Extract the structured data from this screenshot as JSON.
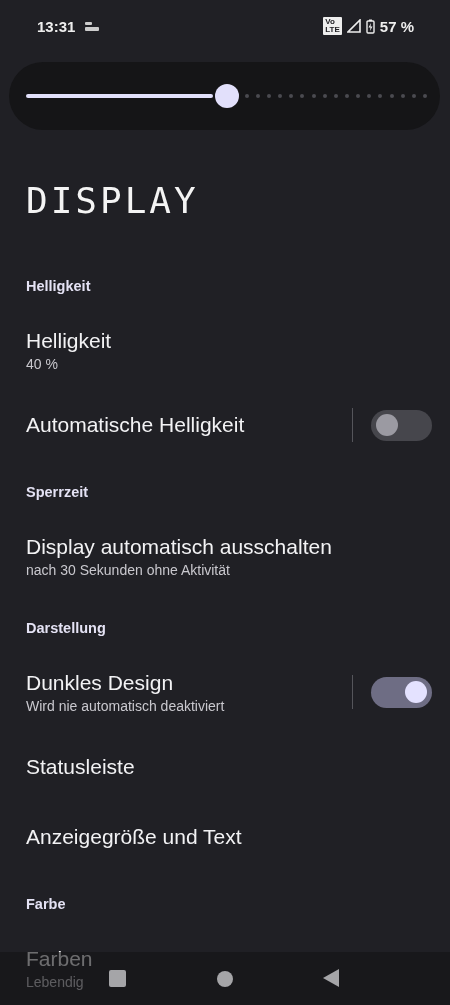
{
  "status_bar": {
    "time": "13:31",
    "network_badge": [
      "Vo",
      "LTE"
    ],
    "battery": "57 %"
  },
  "brightness_slider": {
    "level": 0.5
  },
  "title": "DISPLAY",
  "settings": [
    {
      "kind": "header",
      "title": "Helligkeit"
    },
    {
      "kind": "item",
      "title": "Helligkeit",
      "subtitle": "40 %"
    },
    {
      "kind": "toggle",
      "title": "Automatische Helligkeit",
      "on": false
    },
    {
      "kind": "header",
      "title": "Sperrzeit"
    },
    {
      "kind": "item",
      "title": "Display automatisch ausschalten",
      "subtitle": "nach 30 Sekunden ohne Aktivität"
    },
    {
      "kind": "header",
      "title": "Darstellung"
    },
    {
      "kind": "toggle",
      "title": "Dunkles Design",
      "subtitle": "Wird nie automatisch deaktiviert",
      "on": true
    },
    {
      "kind": "item",
      "title": "Statusleiste"
    },
    {
      "kind": "item",
      "title": "Anzeigegröße und Text"
    },
    {
      "kind": "header",
      "title": "Farbe"
    },
    {
      "kind": "item",
      "title": "Farben",
      "subtitle": "Lebendig"
    }
  ]
}
